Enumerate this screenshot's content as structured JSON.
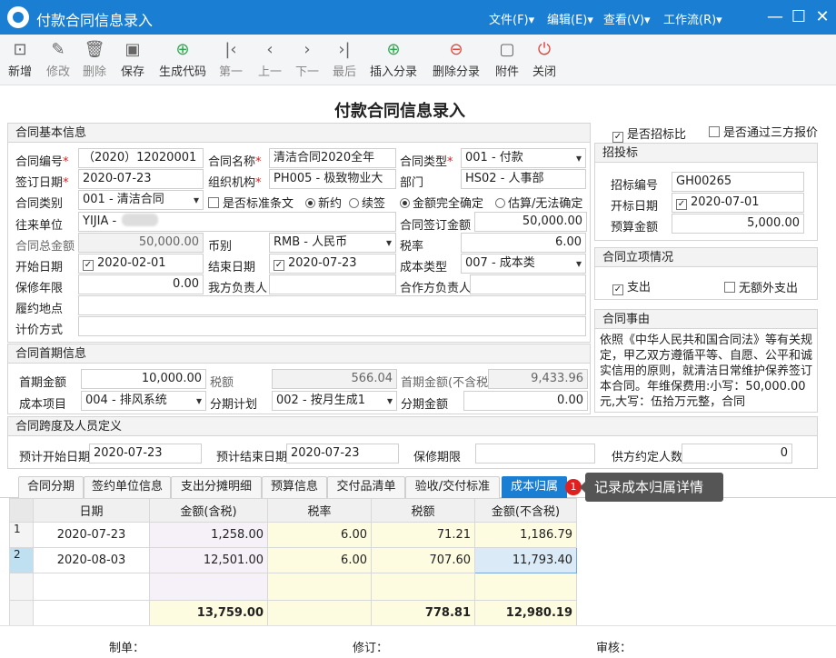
{
  "window": {
    "title": "付款合同信息录入"
  },
  "menus": [
    "文件(F)▾",
    "编辑(E)▾",
    "查看(V)▾",
    "工作流(R)▾"
  ],
  "toolbar": [
    {
      "label": "新增",
      "icon": "new-doc-icon",
      "glyph": "⊡"
    },
    {
      "label": "修改",
      "icon": "edit-icon",
      "glyph": "✎"
    },
    {
      "label": "删除",
      "icon": "trash-icon",
      "glyph": "🗑"
    },
    {
      "label": "保存",
      "icon": "save-icon",
      "glyph": "▣"
    },
    {
      "label": "生成代码",
      "icon": "add-circle-icon",
      "glyph": "⊕"
    },
    {
      "label": "第一",
      "icon": "first-icon",
      "glyph": "|‹"
    },
    {
      "label": "上一",
      "icon": "prev-icon",
      "glyph": "‹"
    },
    {
      "label": "下一",
      "icon": "next-icon",
      "glyph": "›"
    },
    {
      "label": "最后",
      "icon": "last-icon",
      "glyph": "›|"
    },
    {
      "label": "插入分录",
      "icon": "insert-row-icon",
      "glyph": "⊕"
    },
    {
      "label": "删除分录",
      "icon": "delete-row-icon",
      "glyph": "⊖"
    },
    {
      "label": "附件",
      "icon": "attachment-icon",
      "glyph": "▢"
    },
    {
      "label": "关闭",
      "icon": "power-icon",
      "glyph": "⏻"
    }
  ],
  "form_title": "付款合同信息录入",
  "basic": {
    "header": "合同基本信息",
    "contract_no_label": "合同编号",
    "contract_no": "（2020）12020001",
    "contract_name_label": "合同名称",
    "contract_name": "清洁合同2020全年",
    "contract_type_label": "合同类型",
    "contract_type": "001 - 付款",
    "sign_date_label": "签订日期",
    "sign_date": "2020-07-23",
    "org_label": "组织机构",
    "org": "PH005 - 极致物业大",
    "dept_label": "部门",
    "dept": "HS02 - 人事部",
    "category_label": "合同类别",
    "category": "001 - 清洁合同",
    "is_standard_label": "是否标准条文",
    "new_label": "新约",
    "renew_label": "续签",
    "amount_fixed_label": "金额完全确定",
    "amount_est_label": "估算/无法确定",
    "partner_label": "往来单位",
    "partner": "YIJIA -",
    "signed_amount_label": "合同签订金额",
    "signed_amount": "50,000.00",
    "total_label": "合同总金额",
    "total": "50,000.00",
    "currency_label": "币别",
    "currency": "RMB - 人民币",
    "tax_rate_label": "税率",
    "tax_rate": "6.00",
    "start_label": "开始日期",
    "start": "2020-02-01",
    "end_label": "结束日期",
    "end": "2020-07-23",
    "cost_type_label": "成本类型",
    "cost_type": "007 - 成本类",
    "warranty_label": "保修年限",
    "warranty": "0.00",
    "our_owner_label": "我方负责人",
    "partner_owner_label": "合作方负责人",
    "place_label": "履约地点",
    "pricing_label": "计价方式"
  },
  "bid": {
    "is_bid_label": "是否招标比",
    "third_party_label": "是否通过三方报价",
    "header": "招投标",
    "bid_no_label": "招标编号",
    "bid_no": "GH00265",
    "open_date_label": "开标日期",
    "open_date": "2020-07-01",
    "budget_label": "预算金额",
    "budget": "5,000.00"
  },
  "project": {
    "header": "合同立项情况",
    "expense_label": "支出",
    "extra_label": "无额外支出"
  },
  "reason": {
    "header": "合同事由",
    "text": "依照《中华人民共和国合同法》等有关规定，甲乙双方遵循平等、自愿、公平和诚实信用的原则，就清洁日常维护保养签订本合同。年维保费用:小写：50,000.00元,大写：伍拾万元整，合同"
  },
  "first": {
    "header": "合同首期信息",
    "amount_label": "首期金额",
    "amount": "10,000.00",
    "tax_label": "税额",
    "tax": "566.04",
    "amount_notax_label": "首期金额(不含税)",
    "amount_notax": "9,433.96",
    "cost_item_label": "成本项目",
    "cost_item": "004 - 排风系统",
    "plan_label": "分期计划",
    "plan": "002 - 按月生成1",
    "period_amount_label": "分期金额",
    "period_amount": "0.00"
  },
  "span": {
    "header": "合同跨度及人员定义",
    "est_start_label": "预计开始日期",
    "est_start": "2020-07-23",
    "est_end_label": "预计结束日期",
    "est_end": "2020-07-23",
    "warranty_period_label": "保修期限",
    "supplier_count_label": "供方约定人数",
    "supplier_count": "0"
  },
  "tabs": [
    "合同分期",
    "签约单位信息",
    "支出分摊明细",
    "预算信息",
    "交付品清单",
    "验收/交付标准",
    "成本归属"
  ],
  "tip": {
    "badge": "1",
    "text": "记录成本归属详情"
  },
  "grid": {
    "headers": [
      "日期",
      "金额(含税)",
      "税率",
      "税额",
      "金额(不含税)"
    ],
    "rows": [
      [
        "1",
        "2020-07-23",
        "1,258.00",
        "6.00",
        "71.21",
        "1,186.79"
      ],
      [
        "2",
        "2020-08-03",
        "12,501.00",
        "6.00",
        "707.60",
        "11,793.40"
      ]
    ],
    "totals": [
      "",
      "",
      "13,759.00",
      "",
      "778.81",
      "12,980.19"
    ]
  },
  "footer": {
    "maker": "制单：",
    "reviser": "修订：",
    "auditor": "审核："
  }
}
